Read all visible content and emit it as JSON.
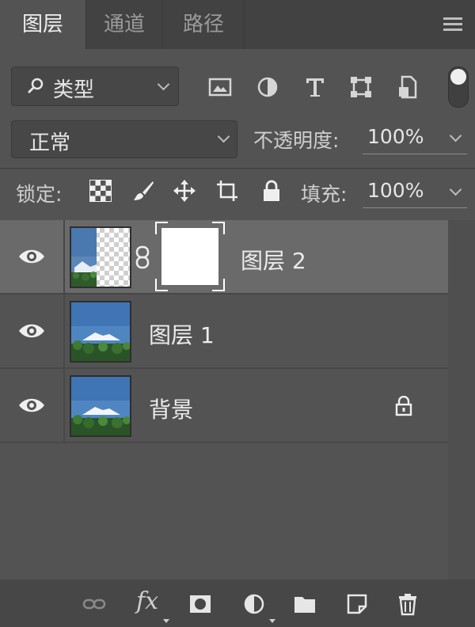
{
  "tabs": [
    {
      "label": "图层",
      "active": true
    },
    {
      "label": "通道",
      "active": false
    },
    {
      "label": "路径",
      "active": false
    }
  ],
  "filter": {
    "label": "类型",
    "icons": [
      "image-filter-icon",
      "adjustment-filter-icon",
      "type-filter-icon",
      "shape-filter-icon",
      "smart-object-filter-icon"
    ]
  },
  "blend": {
    "mode": "正常",
    "opacity_label": "不透明度:",
    "opacity_value": "100%"
  },
  "lock": {
    "label": "锁定:",
    "icons": [
      "lock-transparent-pixels-icon",
      "lock-image-pixels-icon",
      "lock-position-icon",
      "lock-artboard-icon",
      "lock-all-icon"
    ]
  },
  "fill": {
    "label": "填充:",
    "value": "100%"
  },
  "layers": [
    {
      "name": "图层 2",
      "selected": true,
      "has_mask": true,
      "locked": false
    },
    {
      "name": "图层 1",
      "selected": false,
      "has_mask": false,
      "locked": false
    },
    {
      "name": "背景",
      "selected": false,
      "has_mask": false,
      "locked": true
    }
  ],
  "bottom_icons": [
    "link-layers-icon",
    "fx-icon",
    "add-mask-icon",
    "adjustment-layer-icon",
    "new-group-icon",
    "new-layer-icon",
    "delete-layer-icon"
  ],
  "colors": {
    "panel": "#535353",
    "selected": "#6a6a6a",
    "tabbar": "#424242"
  }
}
